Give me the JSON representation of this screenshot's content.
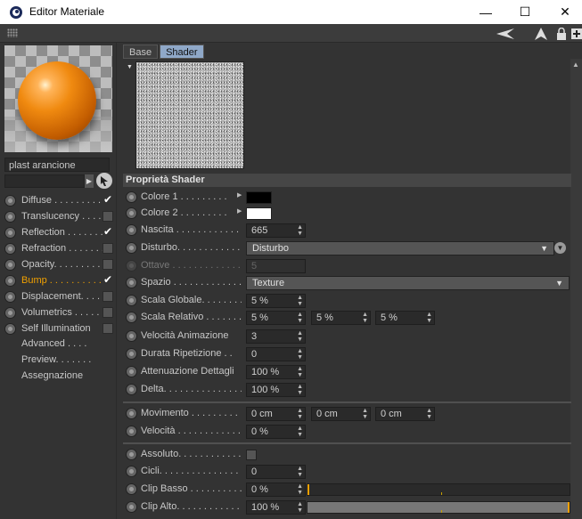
{
  "window": {
    "title": "Editor Materiale",
    "minimize": "—",
    "maximize": "☐",
    "close": "✕"
  },
  "material": {
    "name": "plast arancione"
  },
  "channels": [
    {
      "label": "Diffuse . . . . . . . . . .",
      "checked": true
    },
    {
      "label": "Translucency . . . . .",
      "checked": false
    },
    {
      "label": "Reflection . . . . . . . . .",
      "checked": true
    },
    {
      "label": "Refraction . . . . . . . .",
      "checked": false
    },
    {
      "label": "Opacity. . . . . . . . . . .",
      "checked": false
    },
    {
      "label": "Bump . . . . . . . . . . . . .",
      "checked": true,
      "active": true
    },
    {
      "label": "Displacement. . . . .",
      "checked": false
    },
    {
      "label": "Volumetrics . . . . . .",
      "checked": false
    },
    {
      "label": "Self Illumination",
      "checked": false
    }
  ],
  "extra_items": [
    "Advanced . . . .",
    "Preview. . . . . . .",
    "Assegnazione"
  ],
  "tabs": [
    "Base",
    "Shader"
  ],
  "section_title": "Proprietà Shader",
  "props": {
    "colore1": {
      "label": "Colore 1 . . . . . . . . .",
      "color": "#000000"
    },
    "colore2": {
      "label": "Colore 2 . . . . . . . . .",
      "color": "#ffffff"
    },
    "nascita": {
      "label": "Nascita . . . . . . . . . . . . .",
      "value": "665"
    },
    "disturbo": {
      "label": "Disturbo. . . . . . . . . . . .",
      "value": "Disturbo"
    },
    "ottave": {
      "label": "Ottave . . . . . . . . . . . . . .",
      "value": "5"
    },
    "spazio": {
      "label": "Spazio . . . . . . . . . . . . . .",
      "value": "Texture"
    },
    "scala_globale": {
      "label": "Scala Globale. . . . . . . .",
      "value": "5 %"
    },
    "scala_relativo": {
      "label": "Scala Relativo . . . . . . .",
      "values": [
        "5 %",
        "5 %",
        "5 %"
      ]
    },
    "velocita_animazione": {
      "label": "Velocità Animazione",
      "value": "3"
    },
    "durata_ripetizione": {
      "label": "Durata Ripetizione . .",
      "value": "0"
    },
    "attenuazione": {
      "label": "Attenuazione Dettagli",
      "value": "100 %"
    },
    "delta": {
      "label": "Delta. . . . . . . . . . . . . . . .",
      "value": "100 %"
    },
    "movimento": {
      "label": "Movimento . . . . . . . . .",
      "values": [
        "0 cm",
        "0 cm",
        "0 cm"
      ]
    },
    "velocita": {
      "label": "Velocità . . . . . . . . . . . .",
      "value": "0 %"
    },
    "assoluto": {
      "label": "Assoluto. . . . . . . . . . . .",
      "checked": false
    },
    "cicli": {
      "label": "Cicli. . . . . . . . . . . . . . . .",
      "value": "0"
    },
    "clip_basso": {
      "label": "Clip Basso . . . . . . . . . .",
      "value": "0 %",
      "level": 0
    },
    "clip_alto": {
      "label": "Clip Alto. . . . . . . . . . . .",
      "value": "100 %",
      "level": 100
    }
  },
  "colors": {
    "accent": "#f0a000",
    "tab_selected": "#8fa8c8"
  }
}
